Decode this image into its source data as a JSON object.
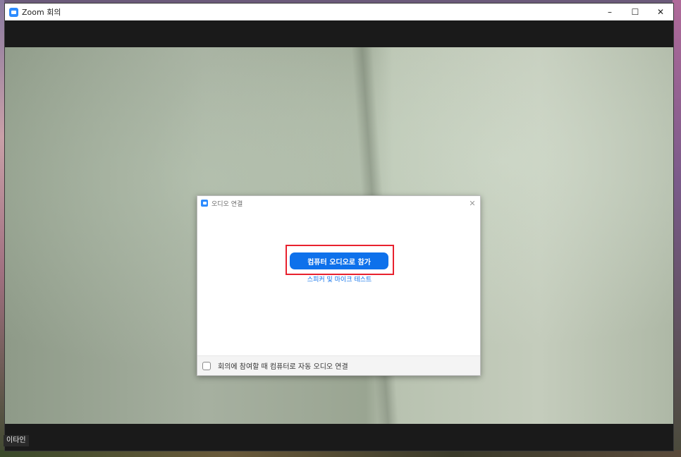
{
  "window": {
    "title": "Zoom 회의",
    "minimize_glyph": "–",
    "maximize_glyph": "☐",
    "close_glyph": "✕"
  },
  "dialog": {
    "title": "오디오 연결",
    "close_glyph": "✕",
    "join_button_label": "컴퓨터 오디오로 참가",
    "test_link_label": "스피커 및 마이크 테스트",
    "auto_join_checkbox_label": "회의에 참여할 때 컴퓨터로 자동 오디오 연결",
    "auto_join_checked": false
  },
  "taskbar": {
    "label": "이타인"
  },
  "icons": {
    "app": "zoom-camera-icon",
    "dialog": "zoom-camera-icon",
    "close": "close-icon"
  },
  "colors": {
    "accent": "#0e71eb",
    "highlight": "#e8212e",
    "toolbar": "#1a1a1a"
  }
}
